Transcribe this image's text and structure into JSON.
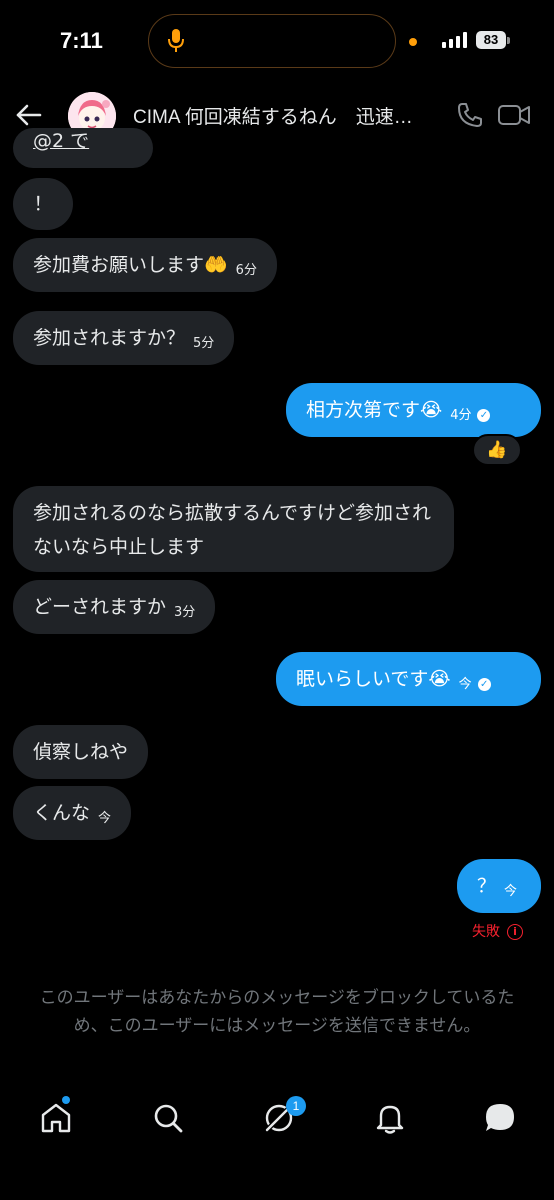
{
  "status_bar": {
    "time": "7:11",
    "battery": "83"
  },
  "header": {
    "title": "CIMA 何回凍結するねん　迅速…"
  },
  "messages": {
    "partial_top": "@2 で ",
    "m1": {
      "text": "！"
    },
    "m2": {
      "text": "参加費お願いします🤲",
      "time": "6分"
    },
    "m3": {
      "text": "参加されますか？",
      "time": "5分"
    },
    "m4": {
      "text": "相方次第です😭",
      "time": "4分",
      "reaction": "👍"
    },
    "m5": {
      "text": "参加されるのなら拡散するんですけど参加されないなら中止します"
    },
    "m6": {
      "text": "どーされますか",
      "time": "3分"
    },
    "m7": {
      "text": "眠いらしいです😭",
      "time": "今"
    },
    "m8": {
      "text": "偵察しねや"
    },
    "m9": {
      "text": "くんな",
      "time": "今"
    },
    "m10": {
      "text": "？",
      "time": "今",
      "status": "失敗"
    }
  },
  "blocked_notice": "このユーザーはあなたからのメッセージをブロックしているため、このユーザーにはメッセージを送信できません。",
  "bottom_nav": {
    "messages_badge": "1"
  },
  "colors": {
    "accent": "#1d9bf0",
    "bubble_in": "#202327",
    "error": "#f4212e"
  }
}
